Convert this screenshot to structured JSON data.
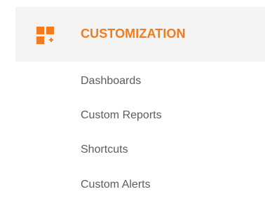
{
  "section": {
    "title": "CUSTOMIZATION",
    "icon": "customization-grid-plus-icon",
    "accent_color": "#f37b1d",
    "header_background": "#f4f4f4"
  },
  "items": [
    {
      "label": "Dashboards"
    },
    {
      "label": "Custom Reports"
    },
    {
      "label": "Shortcuts"
    },
    {
      "label": "Custom Alerts"
    }
  ]
}
